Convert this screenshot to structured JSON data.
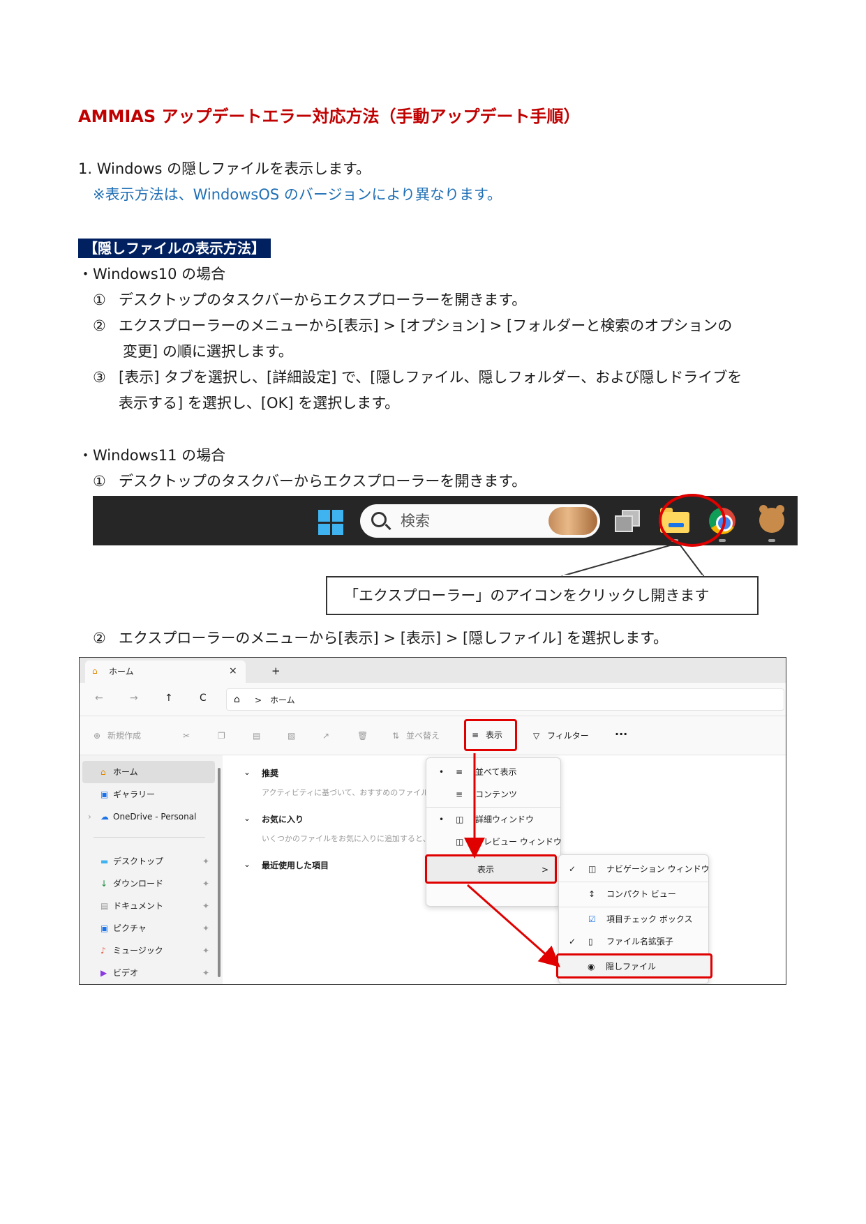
{
  "title": "AMMIAS アップデートエラー対応方法（手動アップデート手順）",
  "step1": {
    "text": "1. Windows の隠しファイルを表示します。",
    "note": "※表示方法は、WindowsOS のバージョンにより異なります。"
  },
  "section_heading": "【隠しファイルの表示方法】",
  "win10": {
    "heading": "・Windows10 の場合",
    "items": [
      {
        "num": "①",
        "lines": [
          "デスクトップのタスクバーからエクスプローラーを開きます。"
        ]
      },
      {
        "num": "②",
        "lines": [
          "エクスプローラーのメニューから[表示] > [オプション] > [フォルダーと検索のオプションの",
          "変更] の順に選択します。"
        ]
      },
      {
        "num": "③",
        "lines": [
          "[表示] タブを選択し、[詳細設定] で、[隠しファイル、隠しフォルダー、および隠しドライブを",
          "表示する] を選択し、[OK] を選択します。"
        ]
      }
    ]
  },
  "win11": {
    "heading": "・Windows11 の場合",
    "item1": {
      "num": "①",
      "text": "デスクトップのタスクバーからエクスプローラーを開きます。"
    },
    "item2": {
      "num": "②",
      "text": "エクスプローラーのメニューから[表示] > [表示] > [隠しファイル] を選択します。"
    }
  },
  "taskbar": {
    "search_placeholder": "検索",
    "icons": [
      "windows-start-icon",
      "search-icon",
      "task-view-icon",
      "file-explorer-icon",
      "chrome-icon",
      "bear-app-icon"
    ],
    "highlight_color": "#e00000"
  },
  "callout": "「エクスプローラー」のアイコンをクリックし開きます",
  "explorer": {
    "tab_title": "ホーム",
    "tab_close": "×",
    "tab_new": "+",
    "breadcrumb": "ホーム",
    "breadcrumb_sep": ">",
    "nav_buttons": [
      "←",
      "→",
      "↑",
      "C"
    ],
    "cmd": {
      "new": "新規作成",
      "sort": "並べ替え",
      "view": "表示",
      "filter": "フィルター",
      "more": "···"
    },
    "nav_items": [
      {
        "label": "ホーム",
        "icon": "home-icon",
        "pin": false,
        "selected": true
      },
      {
        "label": "ギャラリー",
        "icon": "gallery-icon",
        "pin": false,
        "selected": false
      },
      {
        "label": "OneDrive - Personal",
        "icon": "onedrive-icon",
        "pin": false,
        "selected": false
      },
      {
        "label": "デスクトップ",
        "icon": "desktop-icon",
        "pin": true,
        "selected": false
      },
      {
        "label": "ダウンロード",
        "icon": "download-icon",
        "pin": true,
        "selected": false
      },
      {
        "label": "ドキュメント",
        "icon": "document-icon",
        "pin": true,
        "selected": false
      },
      {
        "label": "ピクチャ",
        "icon": "pictures-icon",
        "pin": true,
        "selected": false
      },
      {
        "label": "ミュージック",
        "icon": "music-icon",
        "pin": true,
        "selected": false
      },
      {
        "label": "ビデオ",
        "icon": "video-icon",
        "pin": true,
        "selected": false
      }
    ],
    "sections": [
      {
        "heading": "推奨",
        "sub": "アクティビティに基づいて、おすすめのファイルが"
      },
      {
        "heading": "お気に入り",
        "sub": "いくつかのファイルをお気に入りに追加すると、"
      },
      {
        "heading": "最近使用した項目",
        "sub": ""
      }
    ],
    "view_menu": [
      {
        "label": "並べて表示",
        "bullet": "•"
      },
      {
        "label": "コンテンツ",
        "bullet": ""
      },
      {
        "label": "詳細ウィンドウ",
        "bullet": "•"
      },
      {
        "label": "プレビュー ウィンドウ",
        "bullet": ""
      },
      {
        "label": "表示",
        "bullet": "",
        "arrow": ">"
      }
    ],
    "submenu": [
      {
        "label": "ナビゲーション ウィンドウ",
        "check": "✓"
      },
      {
        "label": "コンパクト ビュー",
        "check": ""
      },
      {
        "label": "項目チェック ボックス",
        "check": ""
      },
      {
        "label": "ファイル名拡張子",
        "check": "✓"
      },
      {
        "label": "隠しファイル",
        "check": ""
      }
    ]
  }
}
